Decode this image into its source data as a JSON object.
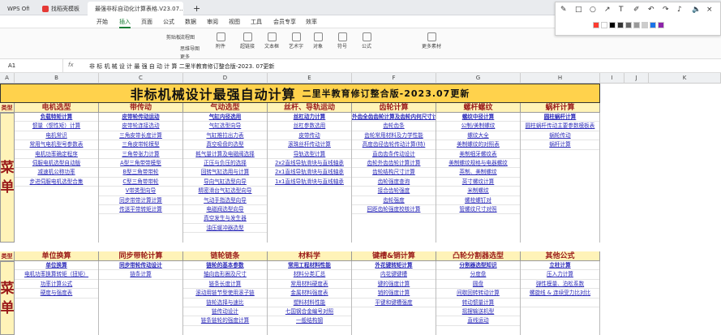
{
  "tabs": [
    {
      "label": "WPS Office",
      "color": "#d9322e"
    },
    {
      "label": "找稻壳模板",
      "color": "#e53935"
    },
    {
      "label": "最强非标自动化计算表格.V23.07...",
      "color": "#1f9d55"
    }
  ],
  "menu": [
    "开始",
    "插入",
    "页面",
    "公式",
    "数据",
    "审阅",
    "视图",
    "工具",
    "会员专享",
    "效率"
  ],
  "menu_active": "插入",
  "ribbon": {
    "small": [
      "剪贴板",
      "流程图",
      "思维导图",
      "更多"
    ],
    "items": [
      "附件",
      "超链接",
      "文本框",
      "艺术字",
      "对象",
      "符号",
      "公式",
      "更多素材"
    ]
  },
  "formula": {
    "cell": "A1",
    "fx": "fx",
    "text": "非 标 机 械 设 计 最 强 自 动 计 算  二里半教育修订整合版-2023. 07更新"
  },
  "columns": [
    "A",
    "B",
    "C",
    "D",
    "E",
    "F",
    "G",
    "H",
    "I",
    "J",
    "K"
  ],
  "title": {
    "main": "非标机械设计最强自动计算",
    "sub": "二里半教育修订整合版-2023.07更新"
  },
  "section1": {
    "side": [
      "类型",
      "菜",
      "单"
    ],
    "headers": [
      "电机选型",
      "带传动",
      "气动选型",
      "丝杆、导轨运动",
      "齿轮计算",
      "螺杆螺纹",
      "蜗杆计算"
    ],
    "cols": [
      [
        "负载特矩计算",
        "惯量（惯性矩）计算",
        "电机常识",
        "常用气电机型号参数表",
        "电机功率确定程序",
        "伺服电机选型自动版",
        "减速机公称功率",
        "步进伺服电机选型合集"
      ],
      [
        "皮带轮传动运动",
        "皮带轮连接选动",
        "三角皮带长度计算",
        "三角皮带轮模型",
        "三角带张力计算",
        "A型三角带带模型",
        "B型三角带带轮",
        "C型三角带带轮",
        "V带类型向导",
        "同步带带计算计算",
        "传送平带转矩计算"
      ],
      [
        "气缸内径选用",
        "气缸选型向导",
        "气缸推拉出力表",
        "真空吸盘的选型",
        "耗气量计算及电磁阀选择",
        "正压与负压的选择",
        "回转气缸选用与计算",
        "导向气缸选型向导",
        "精密滑台气缸选型向导",
        "气动手指选型向导",
        "电磁阀选型向导",
        "真空发生与发生器",
        "油压缓冲器选型"
      ],
      [
        "丝杠动力计算",
        "丝杠参数选用",
        "皮带传动",
        "滚珠丝杆传动计算",
        "导轨选型计算",
        "2x2直线导轨滑块与直线轴承",
        "2x1直线导轨滑块与直线轴承",
        "1x1直线导轨滑块与直线轴承"
      ],
      [
        "外齿全齿齿轮计算及齿轮内何尺寸计算",
        "齿轮齿条",
        "齿轮常用材料及力学性能",
        "高度齿径齿轮传动计算(特)",
        "直齿齿条传动设计",
        "齿轮外齿齿轮计算计算",
        "齿轮结构尺寸计算",
        "齿轮强度查询",
        "接合齿轮强度",
        "齿轮强度",
        "回距齿轮强度校核计算"
      ],
      [
        "螺纹中径计算",
        "公制/美制螺纹",
        "螺纹大全",
        "美制螺纹的对照表",
        "美制细牙螺纹表",
        "美制螺纹规格与电器螺纹",
        "英制、美制螺纹",
        "英寸螺纹计算",
        "米制螺纹",
        "螺栓螺钉对",
        "管螺纹尺寸对照"
      ],
      [
        "圆柱蜗杆计算",
        "圆柱蜗杆传动主要参数模板表",
        "蜗轮传动",
        "蜗杆计算"
      ]
    ]
  },
  "section2": {
    "side": [
      "类型",
      "菜",
      "单"
    ],
    "headers": [
      "单位换算",
      "同步带轮计算",
      "链轮链条",
      "材料学",
      "键槽&销计算",
      "凸轮分割器选型",
      "其他公式"
    ],
    "cols": [
      [
        "单位换算",
        "电机功率换算转矩（扭矩）",
        "功率计算公式",
        "硬度与强度表"
      ],
      [
        "同步带轮传动设计",
        "链条计算"
      ],
      [
        "链轮的基本参数",
        "轴向齿形圈及尺寸",
        "链条长度计算",
        "滚动用链节型使用滚子链",
        "链轮选择与速比",
        "链传动设计",
        "链条链轮的强度计算"
      ],
      [
        "常用工程材料性能",
        "材料分类汇总",
        "常用材料硬度表",
        "金属材料强度表",
        "塑料材料性能",
        "七国钢合金编号对照",
        "一般结构钢"
      ],
      [
        "外花键转矩计算",
        "内花键键槽",
        "键的强度计算",
        "销的强度计算",
        "平键和键槽强度"
      ],
      [
        "分割器选型知识",
        "分度盘",
        "圆盘",
        "间歇回转转动计算",
        "转动惯量计算",
        "摇摆输送机型",
        "直线运动"
      ],
      [
        "立柱计算",
        "压入力计算",
        "弹性模量、泊松系数",
        "螺旋线 & 连续受力比对比",
        ""
      ]
    ]
  },
  "annotation_toolbar": {
    "tools": [
      "pen-tool",
      "rect-tool",
      "circle-tool",
      "arrow-tool",
      "text-tool",
      "pencil-tool",
      "undo-tool",
      "redo-tool",
      "audio-tool",
      "volume-tool",
      "close-tool"
    ],
    "colors": [
      "#ff3b30",
      "#ffffff",
      "#000000",
      "#333333",
      "#666666",
      "#999999",
      "#cccccc",
      "#1a73e8",
      "#8e24aa"
    ]
  }
}
